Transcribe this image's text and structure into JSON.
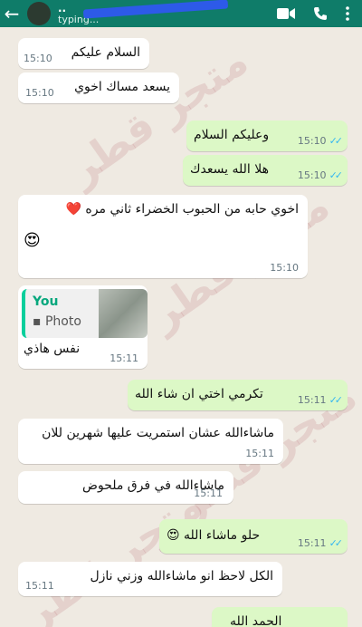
{
  "header": {
    "contact_name": "..",
    "status": "typing..."
  },
  "watermark_text": "متجر قطر",
  "messages": [
    {
      "dir": "in",
      "text": "السلام عليكم",
      "time": "15:10"
    },
    {
      "dir": "in",
      "text": "يسعد مساك اخوي",
      "time": "15:10"
    },
    {
      "dir": "out",
      "text": "وعليكم السلام",
      "time": "15:10"
    },
    {
      "dir": "out",
      "text": "هلا الله يسعدك",
      "time": "15:10"
    },
    {
      "dir": "in",
      "text": "اخوي حابه من الحبوب الخضراء ثاني مره ❤️",
      "text2": "😍",
      "time": "15:10"
    },
    {
      "dir": "in",
      "quote_sender": "You",
      "quote_type": "Photo",
      "text": "نفس هاذي",
      "time": "15:11"
    },
    {
      "dir": "out",
      "text": "تكرمي اختي ان شاء الله",
      "time": "15:11"
    },
    {
      "dir": "in",
      "text": "ماشاءالله عشان استمريت عليها شهرين للان",
      "time": "15:11"
    },
    {
      "dir": "in",
      "text": "ماشاءالله في فرق ملحوض",
      "time": "15:11"
    },
    {
      "dir": "out",
      "text": "حلو ماشاء الله 😍",
      "time": "15:11"
    },
    {
      "dir": "in",
      "text": "الكل لاحظ انو ماشاءالله وزني نازل",
      "time": "15:11"
    },
    {
      "dir": "out",
      "text": "الحمد الله"
    }
  ],
  "colors": {
    "header": "#0f7c69",
    "chat_bg": "#efeae2",
    "incoming_bubble": "#ffffff",
    "outgoing_bubble": "#dcf8c6",
    "read_ticks": "#34b7f1"
  }
}
